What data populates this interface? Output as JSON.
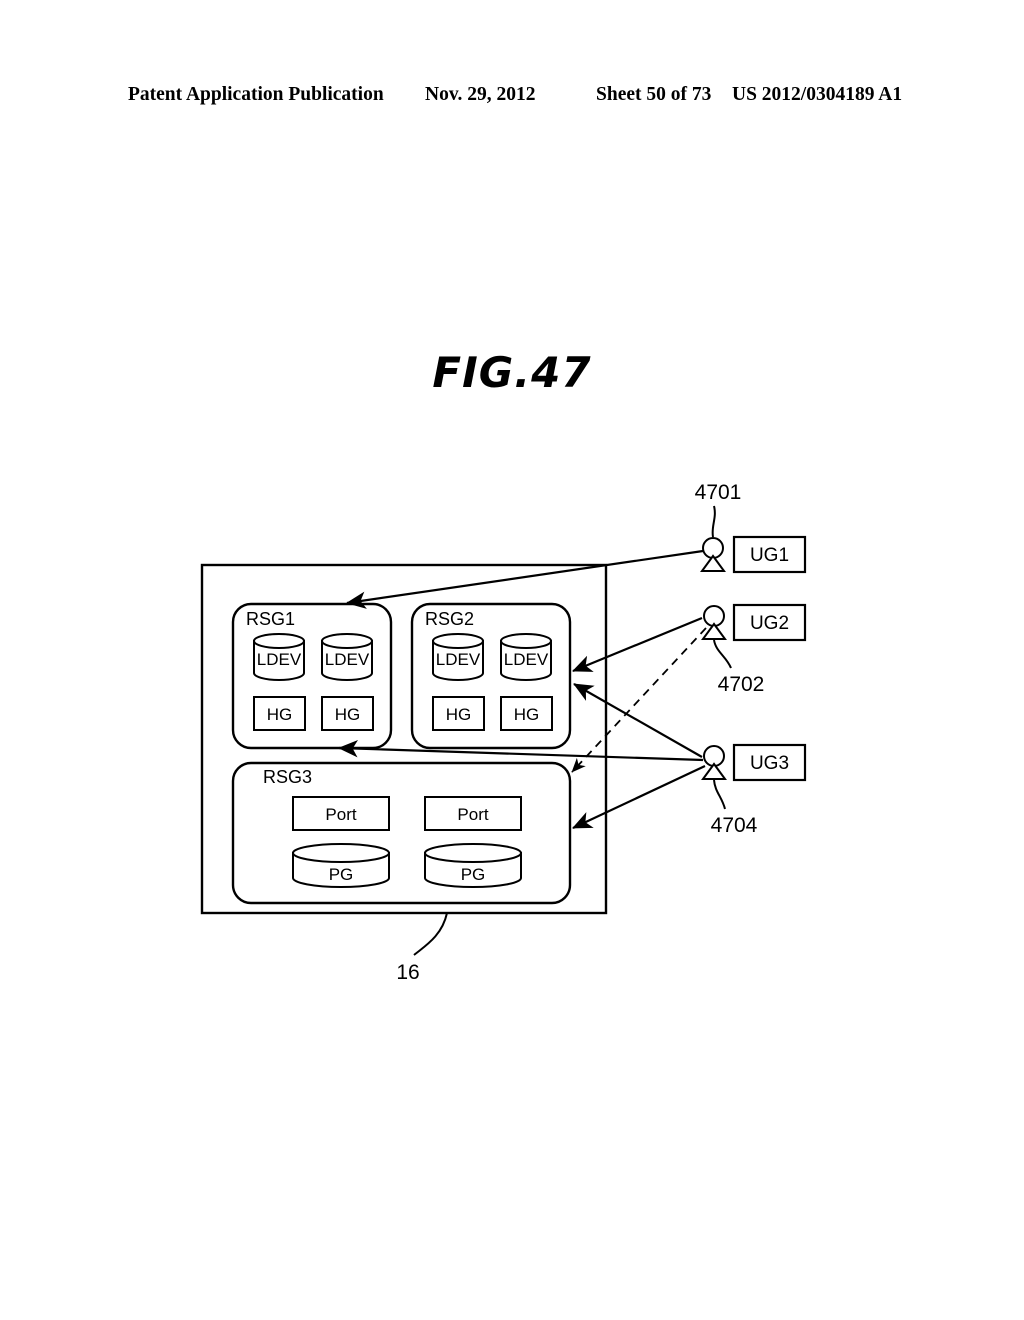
{
  "header": {
    "publication": "Patent Application Publication",
    "date": "Nov. 29, 2012",
    "sheet": "Sheet 50 of 73",
    "document_number": "US 2012/0304189 A1"
  },
  "figure": {
    "title": "FIG.47"
  },
  "diagram": {
    "storage_system_ref": "16",
    "groups": [
      {
        "id": "rsg1",
        "label": "RSG1",
        "resources": [
          {
            "kind": "cylinder",
            "label": "LDEV"
          },
          {
            "kind": "cylinder",
            "label": "LDEV"
          },
          {
            "kind": "box",
            "label": "HG"
          },
          {
            "kind": "box",
            "label": "HG"
          }
        ]
      },
      {
        "id": "rsg2",
        "label": "RSG2",
        "resources": [
          {
            "kind": "cylinder",
            "label": "LDEV"
          },
          {
            "kind": "cylinder",
            "label": "LDEV"
          },
          {
            "kind": "box",
            "label": "HG"
          },
          {
            "kind": "box",
            "label": "HG"
          }
        ]
      },
      {
        "id": "rsg3",
        "label": "RSG3",
        "resources": [
          {
            "kind": "box",
            "label": "Port"
          },
          {
            "kind": "box",
            "label": "Port"
          },
          {
            "kind": "cylinder",
            "label": "PG"
          },
          {
            "kind": "cylinder",
            "label": "PG"
          }
        ]
      }
    ],
    "user_groups": [
      {
        "id": "ug1",
        "label": "UG1",
        "ref": "4701"
      },
      {
        "id": "ug2",
        "label": "UG2",
        "ref": "4702"
      },
      {
        "id": "ug3",
        "label": "UG3",
        "ref": "4704"
      }
    ],
    "connections": [
      {
        "from": "ug1",
        "to": "rsg1",
        "style": "solid"
      },
      {
        "from": "ug2",
        "to": "rsg2",
        "style": "solid"
      },
      {
        "from": "ug2",
        "to": "rsg3",
        "style": "dashed"
      },
      {
        "from": "ug3",
        "to": "rsg1",
        "style": "solid"
      },
      {
        "from": "ug3",
        "to": "rsg2",
        "style": "solid"
      },
      {
        "from": "ug3",
        "to": "rsg3",
        "style": "solid"
      }
    ]
  }
}
